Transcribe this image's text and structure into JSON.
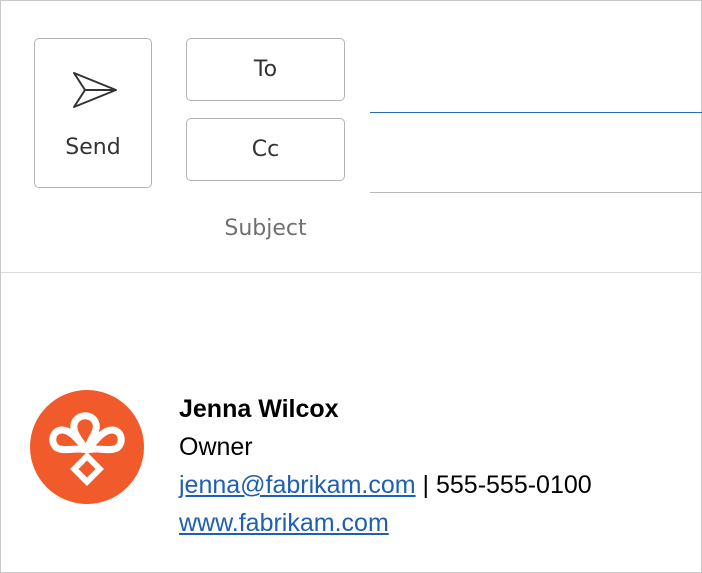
{
  "compose": {
    "send_label": "Send",
    "to_label": "To",
    "cc_label": "Cc",
    "subject_label": "Subject",
    "to_value": "",
    "cc_value": "",
    "subject_value": ""
  },
  "signature": {
    "name": "Jenna Wilcox",
    "title": "Owner",
    "email": "jenna@fabrikam.com",
    "separator": " | ",
    "phone": "555-555-0100",
    "website": "www.fabrikam.com"
  },
  "colors": {
    "logo_bg": "#f15a2b",
    "link": "#1f5fb2",
    "active_underline": "#2b6cb0"
  },
  "icons": {
    "send": "send-icon",
    "logo": "fabrikam-logo"
  }
}
